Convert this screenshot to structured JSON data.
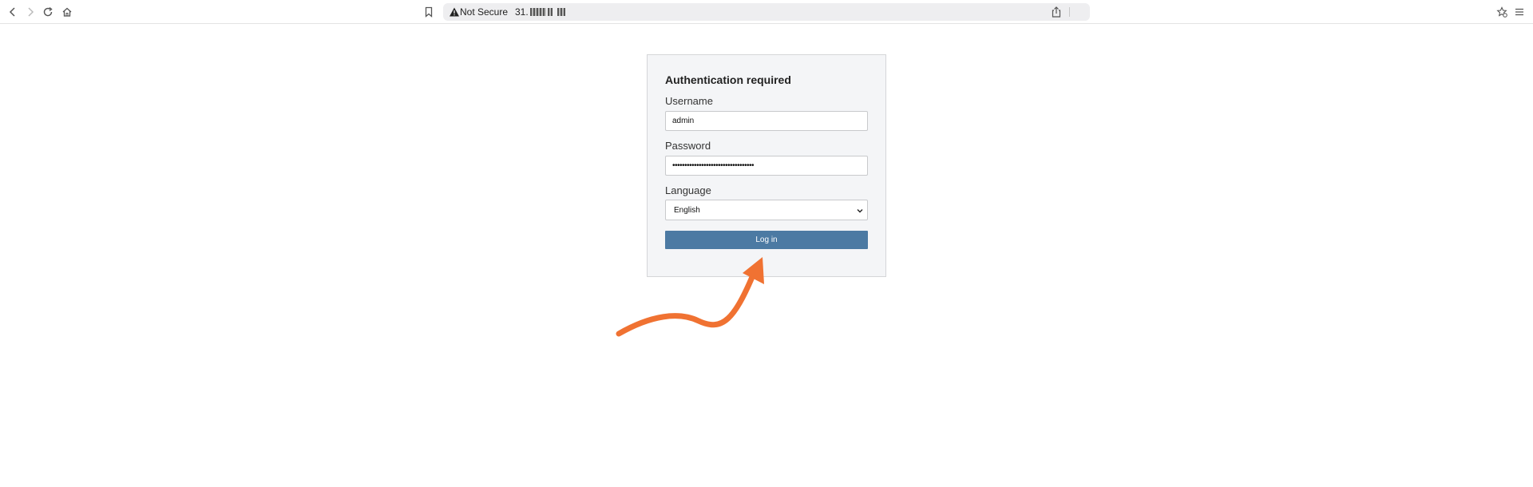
{
  "browser": {
    "address_warning": "Not Secure",
    "address_url_prefix": "31."
  },
  "login": {
    "title": "Authentication required",
    "username_label": "Username",
    "username_value": "admin",
    "password_label": "Password",
    "password_value": "••••••••••••••••••••••••••••••••••",
    "language_label": "Language",
    "language_selected": "English",
    "login_button": "Log in"
  },
  "colors": {
    "primary_button": "#4c7aa3",
    "annotation_arrow": "#f07232"
  },
  "icons": [
    "back-icon",
    "forward-icon",
    "reload-icon",
    "home-icon",
    "bookmark-icon",
    "warning-icon",
    "share-icon",
    "extension-icon",
    "menu-icon",
    "chevron-down-icon"
  ]
}
